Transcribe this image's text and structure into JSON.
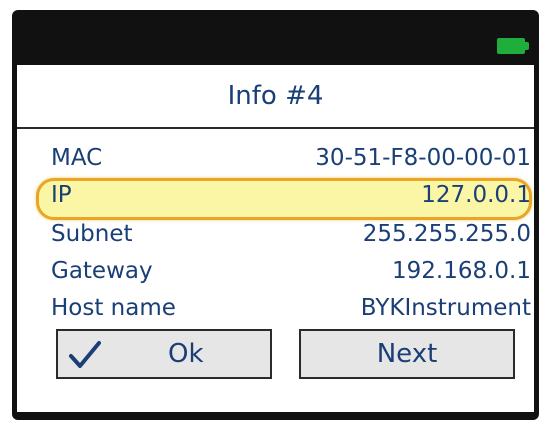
{
  "status_bar": {
    "battery_icon": "battery-full-icon",
    "battery_color": "#1fae3c"
  },
  "screen": {
    "title": "Info #4"
  },
  "info_rows": [
    {
      "label": "MAC",
      "value": "30-51-F8-00-00-01"
    },
    {
      "label": "IP",
      "value": "127.0.0.1"
    },
    {
      "label": "Subnet",
      "value": "255.255.255.0"
    },
    {
      "label": "Gateway",
      "value": "192.168.0.1"
    },
    {
      "label": "Host name",
      "value": "BYKInstrument"
    }
  ],
  "highlighted_row": "IP",
  "highlight_colors": {
    "fill": "#fbf6a6",
    "border": "#e9a623"
  },
  "buttons": {
    "ok_label": "Ok",
    "ok_icon": "checkmark-icon",
    "next_label": "Next"
  },
  "text_color": "#1a3f76"
}
